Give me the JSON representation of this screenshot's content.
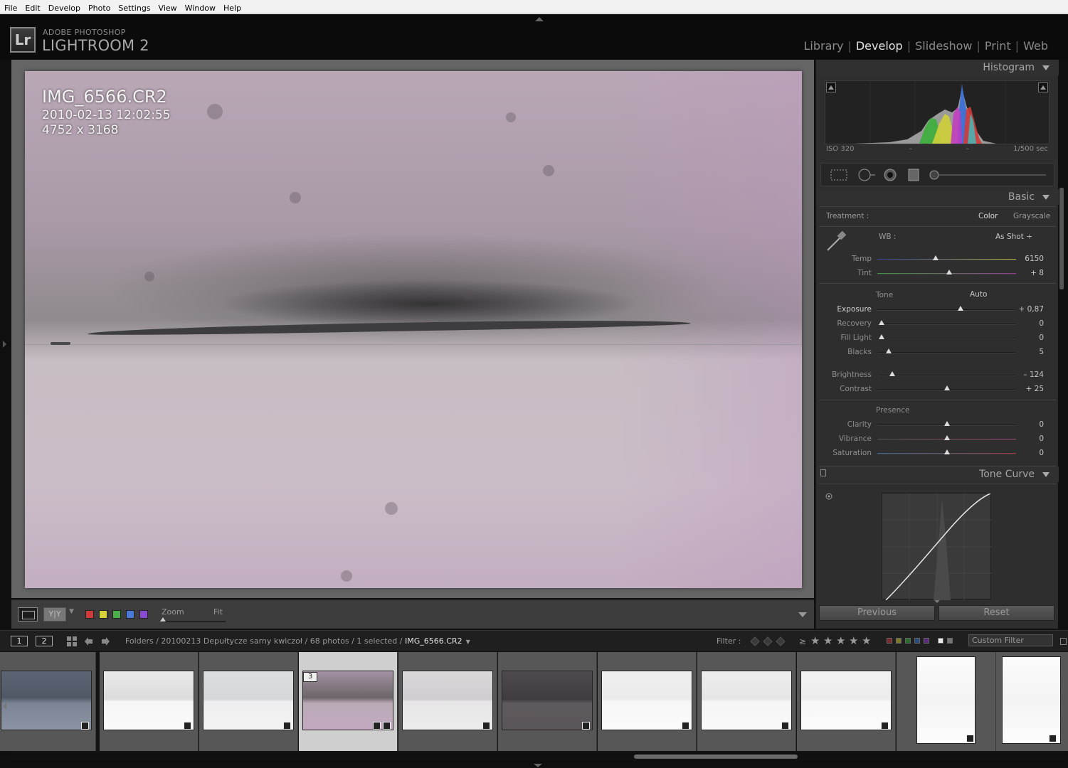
{
  "menu": [
    "File",
    "Edit",
    "Develop",
    "Photo",
    "Settings",
    "View",
    "Window",
    "Help"
  ],
  "brand": {
    "small": "ADOBE PHOTOSHOP",
    "big": "LIGHTROOM 2",
    "badge": "Lr"
  },
  "modules": [
    {
      "label": "Library",
      "active": false
    },
    {
      "label": "Develop",
      "active": true
    },
    {
      "label": "Slideshow",
      "active": false
    },
    {
      "label": "Print",
      "active": false
    },
    {
      "label": "Web",
      "active": false
    }
  ],
  "photo_info": {
    "filename": "IMG_6566.CR2",
    "datetime": "2010-02-13 12:02:55",
    "dimensions": "4752 x 3168"
  },
  "toolbar": {
    "view_yy": "Y|Y",
    "zoom_label": "Zoom",
    "zoom_value": "Fit",
    "color_labels": [
      "#d23a3a",
      "#d6d03a",
      "#4ab04a",
      "#4a7ad6",
      "#8a4ad6"
    ]
  },
  "histogram": {
    "title": "Histogram",
    "iso": "ISO 320",
    "dash1": "–",
    "dash2": "–",
    "shutter": "1/500 sec"
  },
  "basic": {
    "title": "Basic",
    "treatment_label": "Treatment :",
    "treatment_color": "Color",
    "treatment_grayscale": "Grayscale",
    "wb_label": "WB :",
    "wb_value": "As Shot ÷",
    "wb_sliders": [
      {
        "label": "Temp",
        "value": "6150",
        "pos": 0.42
      },
      {
        "label": "Tint",
        "value": "+ 8",
        "pos": 0.52
      }
    ],
    "tone_label": "Tone",
    "auto_label": "Auto",
    "tone_sliders": [
      {
        "label": "Exposure",
        "value": "+ 0,87",
        "pos": 0.6,
        "hi": true
      },
      {
        "label": "Recovery",
        "value": "0",
        "pos": 0.03
      },
      {
        "label": "Fill Light",
        "value": "0",
        "pos": 0.03
      },
      {
        "label": "Blacks",
        "value": "5",
        "pos": 0.08
      }
    ],
    "tone_sliders2": [
      {
        "label": "Brightness",
        "value": "– 124",
        "pos": 0.11
      },
      {
        "label": "Contrast",
        "value": "+ 25",
        "pos": 0.5
      }
    ],
    "presence_label": "Presence",
    "presence_sliders": [
      {
        "label": "Clarity",
        "value": "0",
        "pos": 0.5
      },
      {
        "label": "Vibrance",
        "value": "0",
        "pos": 0.5
      },
      {
        "label": "Saturation",
        "value": "0",
        "pos": 0.5
      }
    ]
  },
  "tone_curve": {
    "title": "Tone Curve"
  },
  "buttons": {
    "previous": "Previous",
    "reset": "Reset"
  },
  "filmstrip_bar": {
    "mon1": "1",
    "mon2": "2",
    "path": "Folders / 20100213 Depułtycze sarny kwiczoł / 68 photos / 1 selected / ",
    "current": "IMG_6566.CR2",
    "filter_label": "Filter :",
    "custom_filter": "Custom Filter"
  },
  "filmstrip": {
    "selected_number": "3",
    "thumbs": [
      {
        "bg": "linear-gradient(180deg,#5d6473 0%,#505866 45%,#7a8494 55%,#8a94a3 100%)"
      },
      {
        "bg": "linear-gradient(180deg,#e9e9ea 0%,#dcdcdd 48%,#f6f6f6 52%,#fafafa 100%)"
      },
      {
        "bg": "linear-gradient(180deg,#dcdddf 0%,#d6d7d9 48%,#eeeeef 52%,#f3f3f4 100%)"
      },
      {
        "bg": "linear-gradient(180deg,#a392a4 0%,#6c6568 45%,#b9aab6 55%,#c4a9c0 100%)"
      },
      {
        "bg": "linear-gradient(180deg,#dad8d9 0%,#cfcdcf 48%,#e7e6e7 52%,#ececec 100%)"
      },
      {
        "bg": "linear-gradient(180deg,#4f4a4e 0%,#3f3b3e 48%,#5f5a5d 55%,#5a5558 100%)"
      },
      {
        "bg": "linear-gradient(180deg,#efefef 0%,#ebebeb 48%,#f7f7f7 52%,#fafafa 100%)"
      },
      {
        "bg": "linear-gradient(180deg,#ededed 0%,#e6e6e6 48%,#f5f5f5 52%,#f9f9f9 100%)"
      },
      {
        "bg": "linear-gradient(180deg,#f1f1f1 0%,#ededed 48%,#f7f7f7 52%,#fbfbfb 100%)"
      },
      {
        "bg": "linear-gradient(180deg,#fbfbfb 0%,#f4f4f4 50%,#fcfcfc 100%)",
        "portrait": true
      },
      {
        "bg": "linear-gradient(180deg,#fbfbfb 0%,#f4f4f4 50%,#fcfcfc 100%)",
        "portrait": true
      }
    ]
  }
}
